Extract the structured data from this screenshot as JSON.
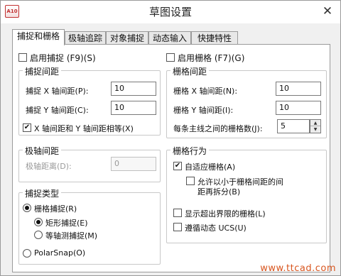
{
  "window": {
    "title": "草图设置",
    "app_icon_text": "A10",
    "close_glyph": "✕"
  },
  "tabs": [
    {
      "label": "捕捉和栅格",
      "active": true
    },
    {
      "label": "极轴追踪",
      "active": false
    },
    {
      "label": "对象捕捉",
      "active": false
    },
    {
      "label": "动态输入",
      "active": false
    },
    {
      "label": "快捷特性",
      "active": false
    }
  ],
  "snap": {
    "enable_label": "启用捕捉 (F9)(S)",
    "enable_checked": false,
    "spacing_title": "捕捉间距",
    "x_label": "捕捉 X 轴间距(P):",
    "x_value": "10",
    "y_label": "捕捉 Y 轴间距(C):",
    "y_value": "10",
    "equal_label": "X 轴间距和 Y 轴间距相等(X)",
    "equal_checked": true,
    "polar_title": "极轴间距",
    "polar_label": "极轴距离(D):",
    "polar_value": "0",
    "type_title": "捕捉类型",
    "grid_snap_label": "栅格捕捉(R)",
    "rect_label": "矩形捕捉(E)",
    "iso_label": "等轴测捕捉(M)",
    "polarsnap_label": "PolarSnap(O)"
  },
  "grid": {
    "enable_label": "启用栅格 (F7)(G)",
    "enable_checked": false,
    "spacing_title": "栅格间距",
    "x_label": "栅格 X 轴间距(N):",
    "x_value": "10",
    "y_label": "栅格 Y 轴间距(I):",
    "y_value": "10",
    "major_label": "每条主线之间的栅格数(J):",
    "major_value": "5",
    "behavior_title": "栅格行为",
    "adaptive_label": "自适应栅格(A)",
    "adaptive_checked": true,
    "subdiv_label_1": "允许以小于栅格间距的间",
    "subdiv_label_2": "距再拆分(B)",
    "subdiv_checked": false,
    "beyond_label": "显示超出界限的栅格(L)",
    "beyond_checked": false,
    "follow_label": "遵循动态 UCS(U)",
    "follow_checked": false
  },
  "icons": {
    "check_glyph": "✔",
    "spin_up_glyph": "▲",
    "spin_down_glyph": "▼"
  },
  "watermark": "www.ttcad.com"
}
